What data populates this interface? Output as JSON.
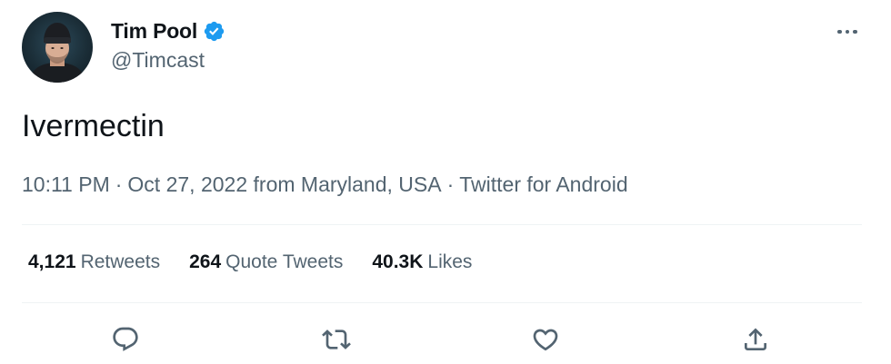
{
  "author": {
    "display_name": "Tim Pool",
    "handle": "@Timcast",
    "verified": true
  },
  "tweet": {
    "text": "Ivermectin",
    "time": "10:11 PM",
    "date": "Oct 27, 2022",
    "location": "from Maryland, USA",
    "client": "Twitter for Android",
    "separator": "·"
  },
  "stats": {
    "retweets_count": "4,121",
    "retweets_label": "Retweets",
    "quotes_count": "264",
    "quotes_label": "Quote Tweets",
    "likes_count": "40.3K",
    "likes_label": "Likes"
  },
  "colors": {
    "text_primary": "#0f1419",
    "text_secondary": "#536471",
    "verified_blue": "#1d9bf0",
    "divider": "#eff3f4"
  },
  "icons": {
    "reply": "reply-icon",
    "retweet": "retweet-icon",
    "like": "heart-icon",
    "share": "share-icon",
    "more": "more-icon",
    "verified": "verified-badge-icon"
  }
}
